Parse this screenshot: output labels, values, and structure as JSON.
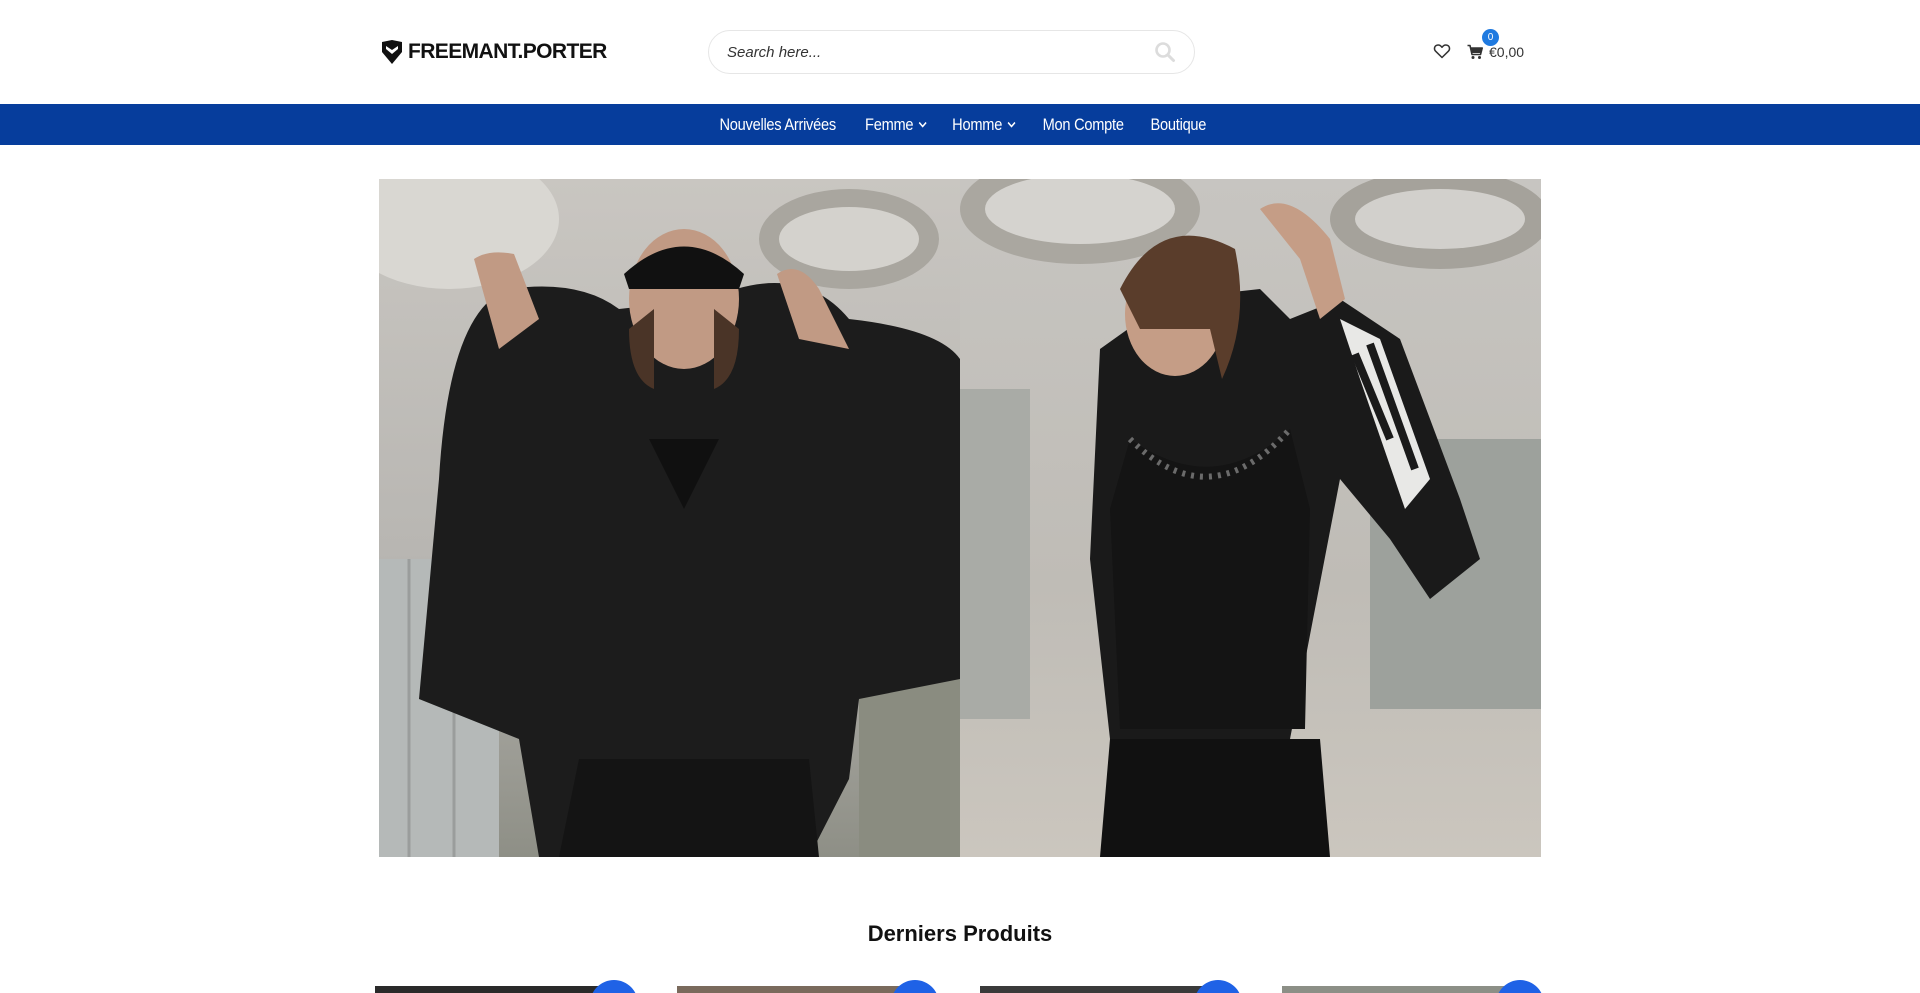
{
  "header": {
    "logo_text": "FREEMANT.PORTER",
    "search": {
      "placeholder": "Search here..."
    },
    "wishlist_icon": "heart-icon",
    "cart": {
      "count": "0",
      "total": "€0,00",
      "icon": "cart-icon"
    }
  },
  "nav": {
    "items": [
      {
        "label": "Nouvelles Arrivées",
        "has_dropdown": false
      },
      {
        "label": "Femme",
        "has_dropdown": true
      },
      {
        "label": "Homme",
        "has_dropdown": true
      },
      {
        "label": "Mon Compte",
        "has_dropdown": false
      },
      {
        "label": "Boutique",
        "has_dropdown": false
      }
    ]
  },
  "hero": {
    "panels": [
      "hero-image-left",
      "hero-image-right"
    ]
  },
  "latest": {
    "title": "Derniers Produits"
  },
  "colors": {
    "nav_background": "#063d9c",
    "accent": "#1f62e6",
    "badge": "#1f7ae0"
  }
}
